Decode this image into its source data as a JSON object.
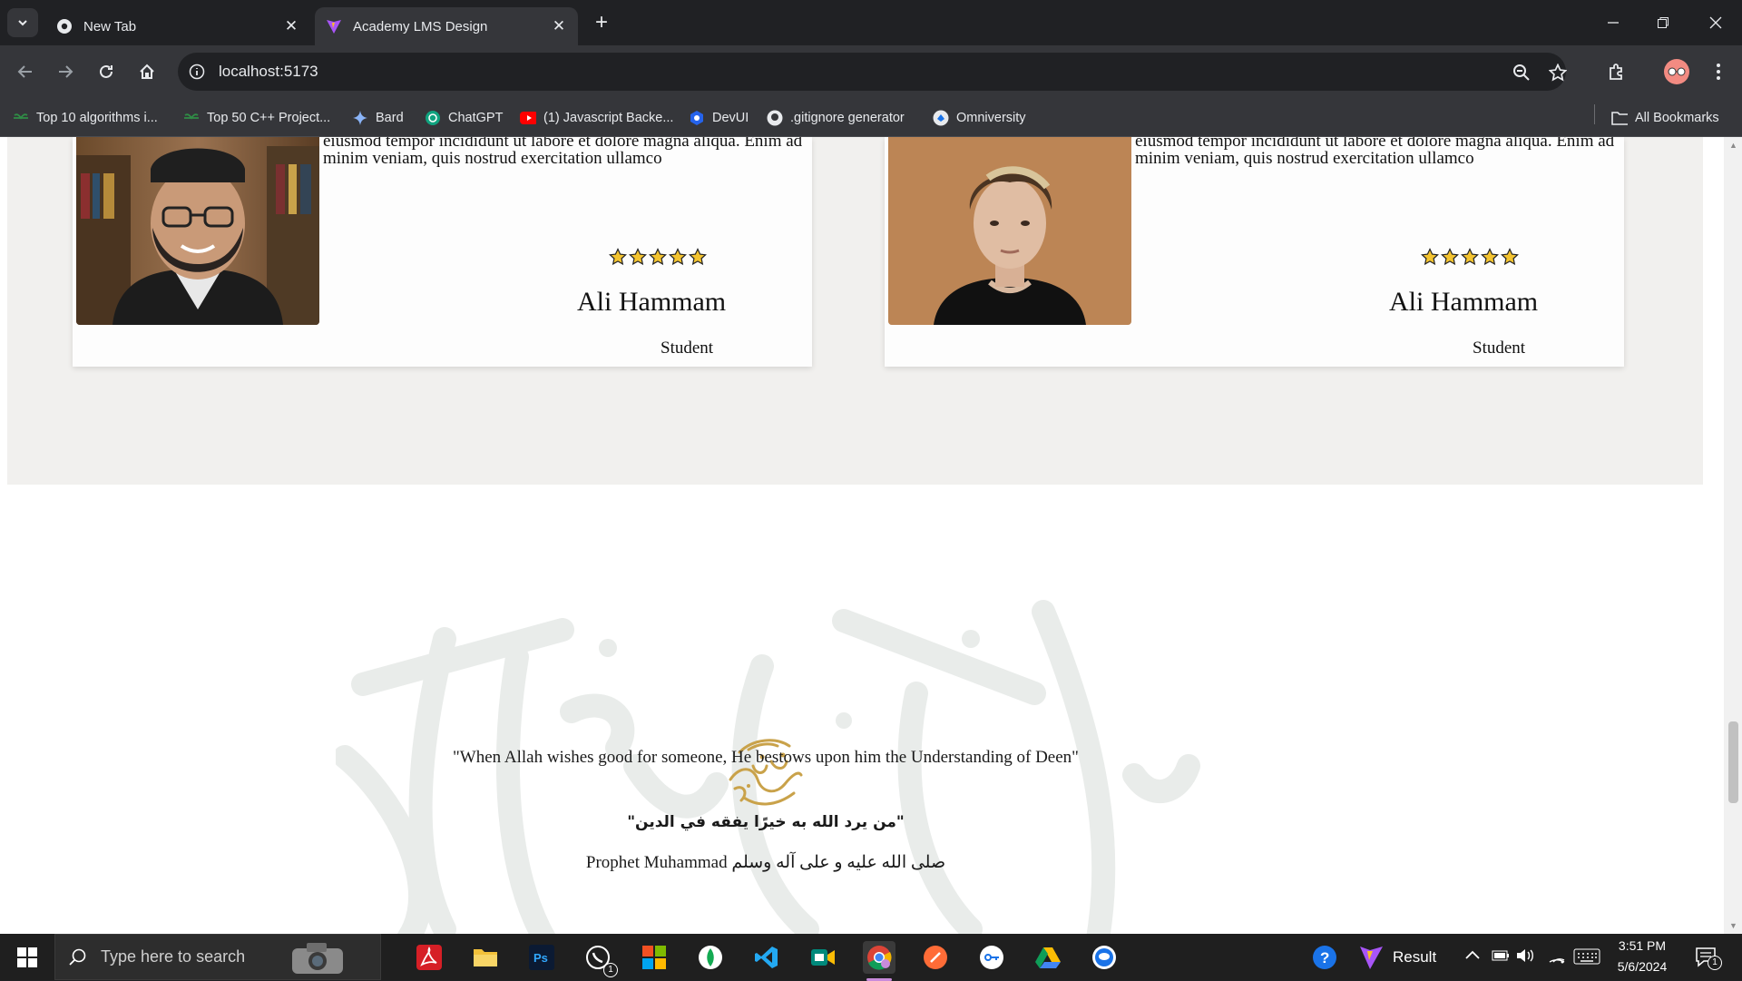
{
  "browser": {
    "tabs": [
      {
        "title": "New Tab",
        "icon": "chrome-icon"
      },
      {
        "title": "Academy LMS Design",
        "icon": "vite-icon",
        "active": true
      }
    ],
    "url": "localhost:5173",
    "bookmarks": [
      {
        "label": "Top 10 algorithms i...",
        "icon": "gfg-icon"
      },
      {
        "label": "Top 50 C++ Project...",
        "icon": "gfg-icon"
      },
      {
        "label": "Bard",
        "icon": "bard-icon"
      },
      {
        "label": "ChatGPT",
        "icon": "chatgpt-icon"
      },
      {
        "label": "(1) Javascript Backe...",
        "icon": "youtube-icon"
      },
      {
        "label": "DevUI",
        "icon": "devui-icon"
      },
      {
        "label": ".gitignore generator",
        "icon": "github-icon"
      },
      {
        "label": "Omniversity",
        "icon": "omniversity-icon"
      }
    ],
    "all_bookmarks_label": "All Bookmarks"
  },
  "testimonials": [
    {
      "text": "eiusmod tempor incididunt ut labore et dolore magna aliqua. Enim ad minim veniam, quis nostrud exercitation ullamco",
      "rating": 5,
      "name": "Ali Hammam",
      "role": "Student"
    },
    {
      "text": "eiusmod tempor incididunt ut labore et dolore magna aliqua. Enim ad minim veniam, quis nostrud exercitation ullamco",
      "rating": 5,
      "name": "Ali Hammam",
      "role": "Student"
    }
  ],
  "quote": {
    "english": "\"When Allah wishes good for someone, He bestows upon him the Understanding of Deen\"",
    "arabic": "\"من يرد الله به خيرًا يفقه في الدين\"",
    "attribution": "Prophet Muhammad صلى الله عليه و على آله وسلم"
  },
  "colors": {
    "accent_gold": "#c9a24a",
    "star_fill": "#f4c430",
    "band_bg": "#f1f0ee"
  },
  "taskbar": {
    "search_placeholder": "Type here to search",
    "result_label": "Result",
    "time": "3:51 PM",
    "date": "5/6/2024",
    "whatsapp_badge": "1",
    "notifications_badge": "1"
  }
}
